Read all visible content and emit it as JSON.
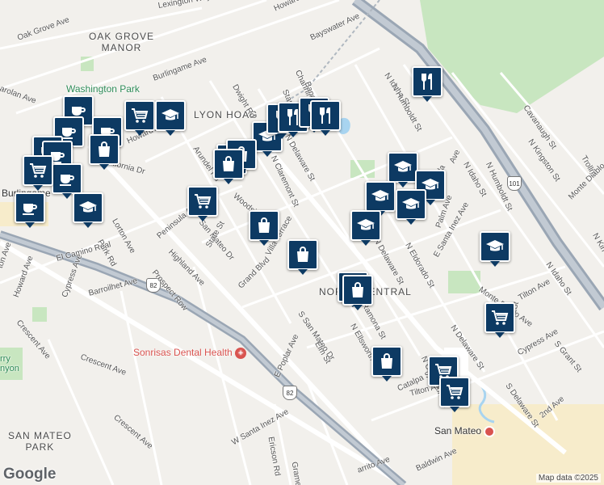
{
  "map": {
    "credit": "Map data ©2025",
    "logo": "Google",
    "neighborhoods": [
      {
        "id": "oak-grove-manor",
        "lines": [
          "OAK GROVE",
          "MANOR"
        ]
      },
      {
        "id": "lyon-hoag",
        "lines": [
          "LYON HOAG"
        ]
      },
      {
        "id": "north-central",
        "lines": [
          "NORTH CENTRAL"
        ]
      },
      {
        "id": "san-mateo-park",
        "lines": [
          "SAN MATEO",
          "PARK"
        ]
      }
    ],
    "places": [
      {
        "id": "washington-park",
        "text": "Washington Park"
      },
      {
        "id": "burlingame",
        "text": "Burlingame"
      },
      {
        "id": "sonrisas-dental-health",
        "text": "Sonrisas Dental Health"
      },
      {
        "id": "san-mateo-station",
        "text": "San Mateo"
      },
      {
        "id": "cherry-canyon",
        "text": "rry\nnyon"
      }
    ],
    "highway_shields": [
      "101",
      "82",
      "82"
    ],
    "streets": [
      "Lexington Way",
      "Oak Grove Ave",
      "Howard Ave",
      "Bayswater Ave",
      "Burlingame Ave",
      "arolan Ave",
      "Channing Ave",
      "Bancroft Rd",
      "Stanley Rd",
      "Dwight Rd",
      "N Idaho St",
      "N Humboldt St",
      "Cavanaugh St",
      "N Kingston St",
      "Trollm",
      "Howard Ave",
      "Arundel Rd",
      "N Claremont St",
      "N Delaware St",
      "ifornia Dr",
      "Woodside Rd",
      "San Mateo Dr",
      "Peninsula Ave",
      "Lorton Ave",
      "Park Rd",
      "Highland Ave",
      "State St",
      "Villa Terrace",
      "Prospect Row",
      "El Camino Real",
      "Howard Ave",
      "Cypress Ave",
      "ton Ave",
      "Barroilhet Ave",
      "Crescent Ave",
      "Grand Blvd",
      "S San Mateo Dr",
      "Ramona St",
      "N Ellsworth Ave",
      "Elm St",
      "E Poplar Ave",
      "Crescent Ave",
      "Crescent Ave",
      "W Santa Inez Ave",
      "Ericson Rd",
      "Gramercy Dr",
      "Catalpa St",
      "N Claremont St",
      "N Delaware St",
      "S Delaware St",
      "Tilton Ave",
      "Tilton Ave",
      "Cypress Ave",
      "S Grant St",
      "2nd Ave",
      "Monte Diablo Ave",
      "E Santa Inez Ave",
      "Baldwin Ave",
      "arrito Ave",
      "N Delaware St",
      "N Idaho St",
      "N Humboldt St",
      "Monte Diablo",
      "N Kin",
      "N Idaho St",
      "Grant St",
      "N Eldorado St",
      "Palm Ave",
      "N Dela",
      "Ave"
    ],
    "markers": [
      {
        "type": "cafe",
        "label": "cafe-icon"
      },
      {
        "type": "cafe",
        "label": "cafe-icon"
      },
      {
        "type": "cafe",
        "label": "cafe-icon"
      },
      {
        "type": "cafe",
        "label": "cafe-icon"
      },
      {
        "type": "cafe",
        "label": "cafe-icon"
      },
      {
        "type": "cafe",
        "label": "cafe-icon"
      },
      {
        "type": "cafe",
        "label": "cafe-icon"
      },
      {
        "type": "grocery",
        "label": "shopping-cart-icon"
      },
      {
        "type": "grocery",
        "label": "shopping-cart-icon"
      },
      {
        "type": "grocery",
        "label": "shopping-cart-icon"
      },
      {
        "type": "grocery",
        "label": "shopping-cart-icon"
      },
      {
        "type": "grocery",
        "label": "shopping-cart-icon"
      },
      {
        "type": "grocery",
        "label": "shopping-cart-icon"
      },
      {
        "type": "school",
        "label": "graduation-cap-icon"
      },
      {
        "type": "school",
        "label": "graduation-cap-icon"
      },
      {
        "type": "school",
        "label": "graduation-cap-icon"
      },
      {
        "type": "school",
        "label": "graduation-cap-icon"
      },
      {
        "type": "school",
        "label": "graduation-cap-icon"
      },
      {
        "type": "school",
        "label": "graduation-cap-icon"
      },
      {
        "type": "school",
        "label": "graduation-cap-icon"
      },
      {
        "type": "school",
        "label": "graduation-cap-icon"
      },
      {
        "type": "school",
        "label": "graduation-cap-icon"
      },
      {
        "type": "restaurant",
        "label": "fork-knife-icon"
      },
      {
        "type": "restaurant",
        "label": "fork-knife-icon"
      },
      {
        "type": "restaurant",
        "label": "fork-knife-icon"
      },
      {
        "type": "restaurant",
        "label": "fork-knife-icon"
      },
      {
        "type": "restaurant",
        "label": "fork-knife-icon"
      },
      {
        "type": "shopping",
        "label": "shopping-bag-icon"
      },
      {
        "type": "shopping",
        "label": "shopping-bag-icon"
      },
      {
        "type": "shopping",
        "label": "shopping-bag-icon"
      },
      {
        "type": "shopping",
        "label": "shopping-bag-icon"
      },
      {
        "type": "shopping",
        "label": "shopping-bag-icon"
      },
      {
        "type": "shopping",
        "label": "shopping-bag-icon"
      },
      {
        "type": "shopping",
        "label": "shopping-bag-icon"
      },
      {
        "type": "shopping",
        "label": "shopping-bag-icon"
      },
      {
        "type": "shopping",
        "label": "shopping-bag-icon"
      }
    ],
    "colors": {
      "marker": "#0d3a63",
      "highway": "#9aa6b4",
      "park": "#c8e6c0",
      "poi": "#d9534f",
      "land": "#f2f0ec",
      "water": "#a8d4f0"
    }
  }
}
